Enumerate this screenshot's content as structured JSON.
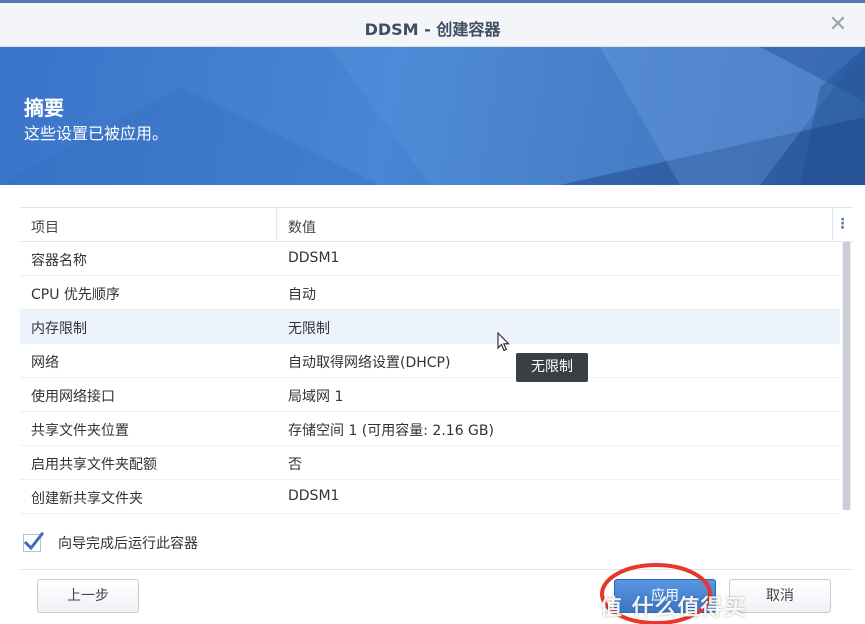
{
  "window": {
    "title": "DDSM - 创建容器",
    "close_icon": "close-icon"
  },
  "banner": {
    "heading": "摘要",
    "subtitle": "这些设置已被应用。"
  },
  "table": {
    "headers": {
      "item": "项目",
      "value": "数值"
    },
    "rows": [
      {
        "item": "容器名称",
        "value": "DDSM1"
      },
      {
        "item": "CPU 优先顺序",
        "value": "自动"
      },
      {
        "item": "内存限制",
        "value": "无限制"
      },
      {
        "item": "网络",
        "value": "自动取得网络设置(DHCP)"
      },
      {
        "item": "使用网络接口",
        "value": "局域网 1"
      },
      {
        "item": "共享文件夹位置",
        "value": "存储空间 1 (可用容量: 2.16 GB)"
      },
      {
        "item": "启用共享文件夹配额",
        "value": "否"
      },
      {
        "item": "创建新共享文件夹",
        "value": "DDSM1"
      }
    ],
    "highlighted_row": 2
  },
  "tooltip": {
    "text": "无限制"
  },
  "options": {
    "run_after_wizard_label": "向导完成后运行此容器",
    "run_after_wizard_checked": true
  },
  "buttons": {
    "back": "上一步",
    "apply": "应用",
    "cancel": "取消"
  },
  "watermark": {
    "text": "值 什么值得买"
  },
  "colors": {
    "accent": "#4f79b4",
    "banner": "#3a74c9",
    "annotation": "#e8362b"
  }
}
